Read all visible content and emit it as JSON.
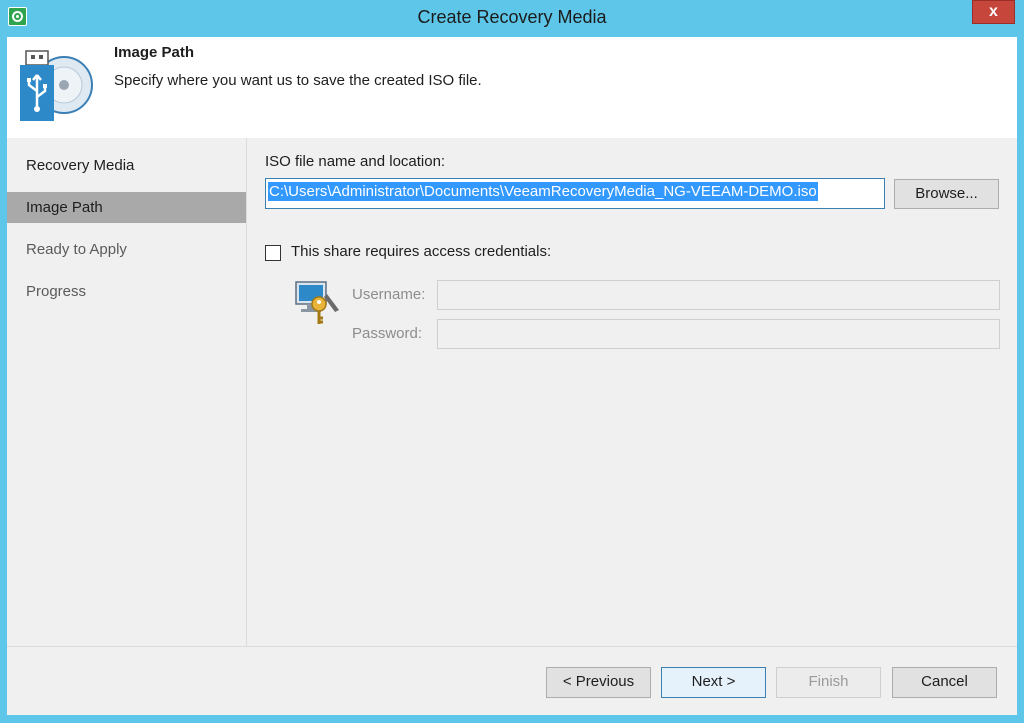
{
  "window": {
    "title": "Create Recovery Media",
    "close_label": "x"
  },
  "header": {
    "title": "Image Path",
    "description": "Specify where you want us to save the created ISO file.",
    "icon": "usb-disc-icon"
  },
  "sidebar": {
    "items": [
      {
        "label": "Recovery Media",
        "state": "normal"
      },
      {
        "label": "Image Path",
        "state": "active"
      },
      {
        "label": "Ready to Apply",
        "state": "disabled"
      },
      {
        "label": "Progress",
        "state": "disabled"
      }
    ]
  },
  "main": {
    "iso_label": "ISO file name and location:",
    "iso_path": "C:\\Users\\Administrator\\Documents\\VeeamRecoveryMedia_NG-VEEAM-DEMO.iso",
    "browse_label": "Browse...",
    "credentials_checkbox_label": "This share requires access credentials:",
    "credentials_checked": false,
    "username_label": "Username:",
    "username_value": "",
    "password_label": "Password:",
    "password_value": ""
  },
  "footer": {
    "previous_label": "< Previous",
    "next_label": "Next >",
    "finish_label": "Finish",
    "cancel_label": "Cancel"
  },
  "colors": {
    "title_bar": "#5ec6e8",
    "close_button": "#c7463c",
    "selection": "#3399ff",
    "active_step": "#a9a9a9"
  }
}
